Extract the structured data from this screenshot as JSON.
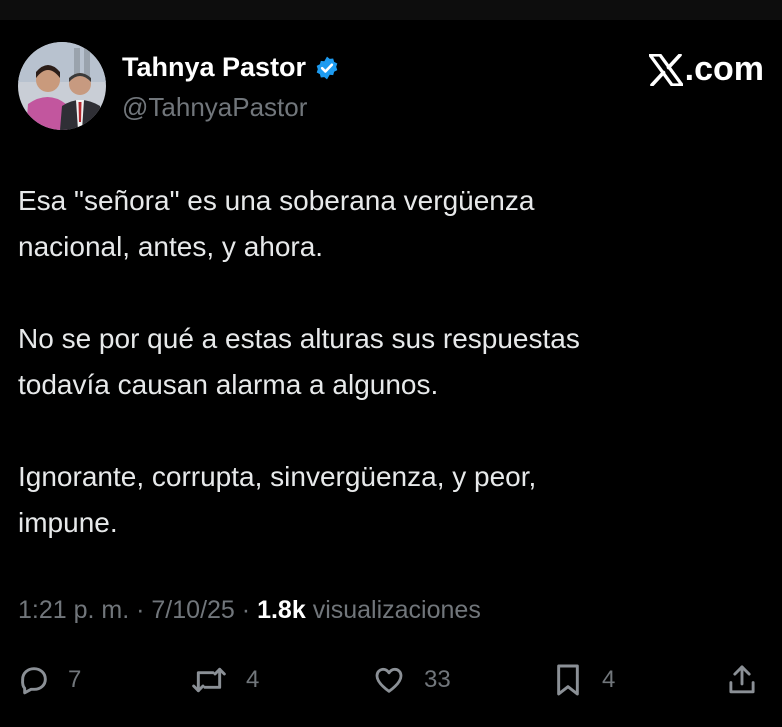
{
  "author": {
    "name": "Tahnya Pastor",
    "handle": "@TahnyaPastor",
    "verified": true
  },
  "site": {
    "logo_text": ".com"
  },
  "tweet": {
    "paragraphs": [
      "Esa \"señora\" es una soberana vergüenza\nnacional, antes, y ahora.",
      "No se por qué a estas alturas sus respuestas\ntodavía causan alarma a algunos.",
      "Ignorante, corrupta, sinvergüenza, y peor,\nimpune."
    ]
  },
  "meta": {
    "time": "1:21 p. m.",
    "separator": "·",
    "date": "7/10/25",
    "views_count": "1.8k",
    "views_label": "visualizaciones"
  },
  "actions": {
    "replies": "7",
    "reposts": "4",
    "likes": "33",
    "bookmarks": "4"
  },
  "colors": {
    "background": "#000000",
    "text": "#e7e9ea",
    "muted": "#71767b",
    "verified": "#1d9bf0"
  }
}
